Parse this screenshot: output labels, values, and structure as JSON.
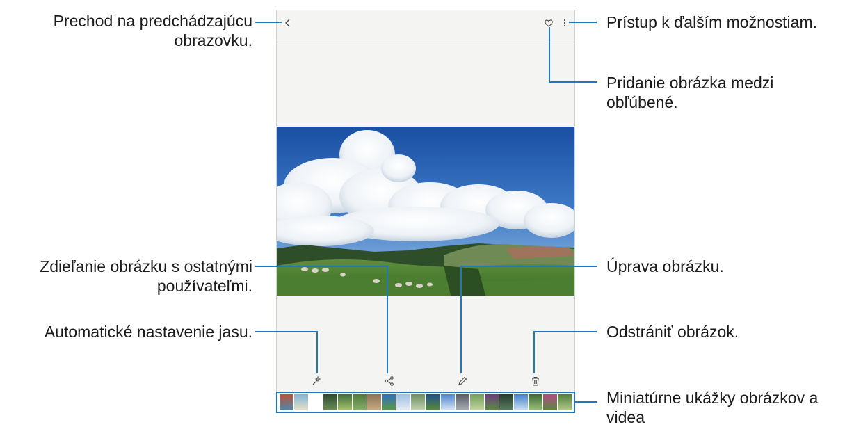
{
  "callouts": {
    "back": [
      "Prechod na predchádzajúcu",
      "obrazovku."
    ],
    "more": "Prístup k ďalším možnostiam.",
    "favorite": [
      "Pridanie obrázka medzi",
      "obľúbené."
    ],
    "share": [
      "Zdieľanie obrázku s ostatnými",
      "používateľmi."
    ],
    "edit": "Úprava obrázku.",
    "auto_brightness": "Automatické nastavenie jasu.",
    "delete": "Odstrániť obrázok.",
    "thumbnails": [
      "Miniatúrne ukážky obrázkov a",
      "videa"
    ]
  },
  "icons": {
    "back": "back-arrow-icon",
    "favorite": "heart-icon",
    "more": "more-options-icon",
    "auto_brightness": "magic-wand-icon",
    "share": "share-icon",
    "edit": "pencil-icon",
    "delete": "trash-icon"
  },
  "thumbnails": [
    {
      "scene": "coastal cliffs",
      "colors": [
        "#b8543a",
        "#4f89a8"
      ]
    },
    {
      "scene": "beach",
      "colors": [
        "#7fb4d8",
        "#e7e0c7"
      ]
    },
    {
      "scene": "blank",
      "colors": [
        "#ffffff",
        "#ffffff"
      ]
    },
    {
      "scene": "forest",
      "colors": [
        "#2c4a2a",
        "#6c8f5a"
      ]
    },
    {
      "scene": "garden",
      "colors": [
        "#3e6e3d",
        "#a9c26d"
      ]
    },
    {
      "scene": "plants",
      "colors": [
        "#4f7a3b",
        "#8ab06a"
      ]
    },
    {
      "scene": "rock",
      "colors": [
        "#8c7355",
        "#c8ab84"
      ]
    },
    {
      "scene": "sky field",
      "colors": [
        "#2d6fc1",
        "#5d9a3e"
      ]
    },
    {
      "scene": "clouds",
      "colors": [
        "#9dc1e6",
        "#e6ecf2"
      ]
    },
    {
      "scene": "hills",
      "colors": [
        "#6d8e62",
        "#c3d2b0"
      ]
    },
    {
      "scene": "lake",
      "colors": [
        "#1f4f8a",
        "#5b8c3c"
      ]
    },
    {
      "scene": "sky clouds",
      "colors": [
        "#4a86cf",
        "#d9e6f2"
      ]
    },
    {
      "scene": "stone",
      "colors": [
        "#5a5d63",
        "#a9aeb5"
      ]
    },
    {
      "scene": "field",
      "colors": [
        "#6f9f57",
        "#c4d6a2"
      ]
    },
    {
      "scene": "purple flower",
      "colors": [
        "#6a3d7d",
        "#5e8d43"
      ]
    },
    {
      "scene": "dark trees",
      "colors": [
        "#253c2c",
        "#5c7d61"
      ]
    },
    {
      "scene": "blue sky",
      "colors": [
        "#3f81cd",
        "#cfe0ef"
      ]
    },
    {
      "scene": "green hills",
      "colors": [
        "#3d6a35",
        "#9ec07c"
      ]
    },
    {
      "scene": "pink flowers",
      "colors": [
        "#b54a86",
        "#5a8a3e"
      ]
    },
    {
      "scene": "meadow",
      "colors": [
        "#4e7f3a",
        "#b5c98c"
      ]
    }
  ],
  "colors": {
    "accent": "#1d78c1",
    "screen_bg": "#f4f5f2"
  }
}
